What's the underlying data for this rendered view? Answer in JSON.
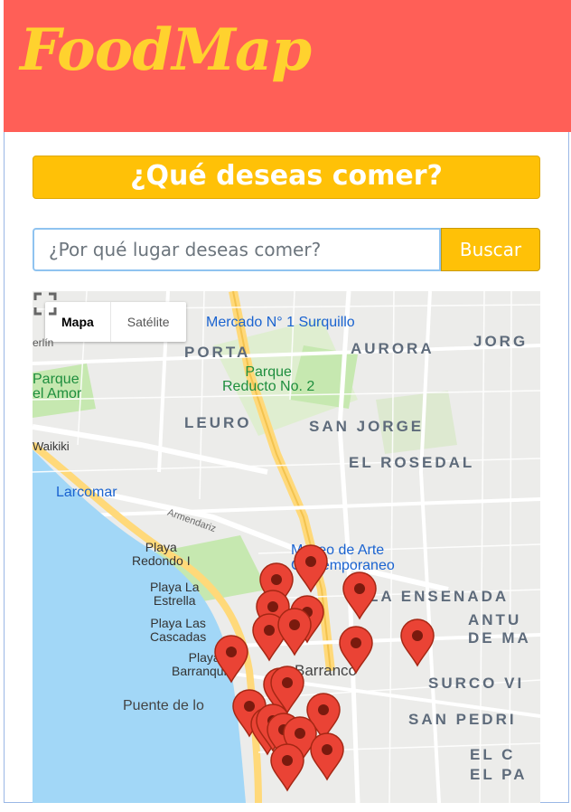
{
  "app": {
    "logo": "FoodMap"
  },
  "heading": {
    "question": "¿Qué deseas comer?"
  },
  "search": {
    "placeholder": "¿Por qué lugar deseas comer?",
    "button_label": "Buscar"
  },
  "map": {
    "type_controls": {
      "map_label": "Mapa",
      "satellite_label": "Satélite",
      "selected": "Mapa"
    },
    "icons": [
      "fullscreen-icon",
      "map-pin-icon"
    ],
    "labels": {
      "mercado": "Mercado N° 1 Surquillo",
      "porta": "PORTA",
      "aurora": "AURORA",
      "jorge_cut": "JORG",
      "parque_amor": "Parque\nel Amor",
      "reducto": "Parque\nReducto No. 2",
      "leuro": "LEURO",
      "san_jorge": "SAN JORGE",
      "el_rosedal": "EL ROSEDAL",
      "waikiki": "Waikiki",
      "larcomar": "Larcomar",
      "armendariz": "Armendariz",
      "museo": "Museo de Arte\nContemporaneo",
      "redondo": "Playa\nRedondo I",
      "estrella": "Playa La\nEstrella",
      "cascadas": "Playa Las\nCascadas",
      "barranquito": "Playa\nBarranquito",
      "barranco": "Barranco",
      "ensenada": "LA ENSENADA",
      "antu": "ANTU\nDE MA",
      "surco": "SURCO VI",
      "san_pedro": "SAN PEDRI",
      "el_c": "EL C\nEL PA",
      "puente": "Puente de lo",
      "erlin": "erlín"
    },
    "accent_color": "#ea4335",
    "pin_count": 20
  },
  "colors": {
    "header": "#ff5f57",
    "logo": "#ffd22e",
    "accent": "#ffc107",
    "sea": "#a2d7f7",
    "park": "#c6e8b0"
  }
}
